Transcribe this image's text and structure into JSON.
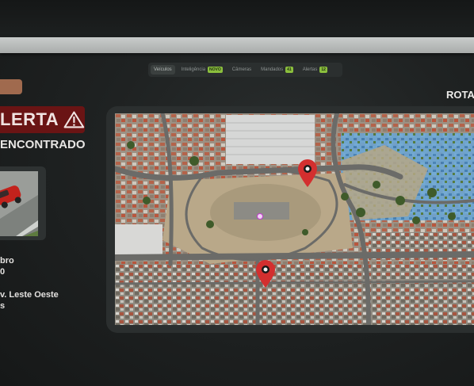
{
  "nav": {
    "tabs": [
      {
        "label": "Veículos",
        "badge": ""
      },
      {
        "label": "Inteligência",
        "badge": "NOVO"
      },
      {
        "label": "Câmeras",
        "badge": ""
      },
      {
        "label": "Mandados",
        "badge": "41"
      },
      {
        "label": "Alertas",
        "badge": "12"
      }
    ]
  },
  "back": {
    "label": ""
  },
  "alert": {
    "title": "LERTA",
    "icon": "warning-triangle-icon"
  },
  "status": {
    "label": "ENCONTRADO"
  },
  "details": {
    "line1": "bro",
    "line2": "0",
    "line3": "v. Leste Oeste",
    "line4": "s"
  },
  "map": {
    "heading": "ROTA",
    "pin_icon": "map-pin-icon",
    "colors": {
      "pin": "#d32f2f",
      "water_overlay": "#5fa8e0"
    }
  }
}
